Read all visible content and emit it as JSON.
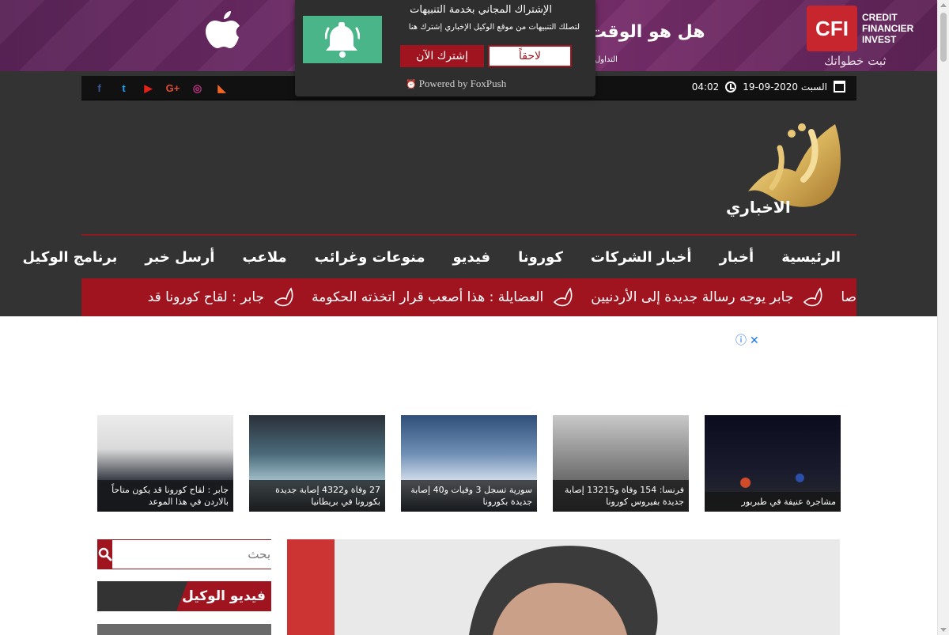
{
  "ad": {
    "headline": "هل هو الوقت",
    "subline": "التداول",
    "cfi_badge": "CFI",
    "cfi_lines": [
      "CREDIT",
      "FINANCIER",
      "INVEST"
    ],
    "cfi_tagline": "ثبت خطواتك"
  },
  "push": {
    "title": "الإشتراك المجاني بخدمة التنبيهات",
    "description": "لتصلك التنبيهات من موقع الوكيل الإخباري إشترك هنا",
    "later_label": "لاحقاً",
    "subscribe_label": "إشترك الآن",
    "powered_by": "Powered by FoxPush"
  },
  "topbar": {
    "date": "السبت 2020-09-19",
    "time": "04:02",
    "social": [
      {
        "name": "facebook-icon",
        "glyph": "f",
        "color": "#3b5998"
      },
      {
        "name": "twitter-icon",
        "glyph": "t",
        "color": "#1da1f2"
      },
      {
        "name": "youtube-icon",
        "glyph": "▶",
        "color": "#e62117"
      },
      {
        "name": "google-plus-icon",
        "glyph": "G+",
        "color": "#dd4b39"
      },
      {
        "name": "instagram-icon",
        "glyph": "◎",
        "color": "#c13584"
      },
      {
        "name": "rss-icon",
        "glyph": "◣",
        "color": "#f26522"
      }
    ]
  },
  "logo": {
    "main": "الوكيل",
    "sub": "الاخباري"
  },
  "nav": {
    "items": [
      "الرئيسية",
      "أخبار",
      "أخبار الشركات",
      "كورونا",
      "فيديو",
      "منوعات وغرائب",
      "ملاعب",
      "أرسل خبر",
      "برنامج الوكيل"
    ]
  },
  "ticker": {
    "items": [
      "صا",
      "جابر يوجه رسالة جديدة إلى الأردنيين",
      "العضايلة : هذا أصعب قرار اتخذته الحكومة",
      "جابر : لقاح كورونا قد"
    ]
  },
  "adchoices": {
    "info": "ⓘ",
    "close": "✕"
  },
  "thumbs": [
    {
      "caption": "مشاجرة عنيفة في طبربور"
    },
    {
      "caption": "فرنسا: 154 وفاة و13215 إصابة جديدة بفيروس كورونا"
    },
    {
      "caption": "سورية تسجل 3 وفيات و40 إصابة جديدة بكورونا"
    },
    {
      "caption": "27 وفاة و4322 إصابة جديدة بكورونا في بريطانيا"
    },
    {
      "caption": "جابر : لقاح كورونا قد يكون متاحاً بالاردن في هذا الموعد"
    }
  ],
  "search": {
    "placeholder": "بحث"
  },
  "video_section": {
    "title": "فيديو الوكيل"
  },
  "colors": {
    "brand_red": "#a0141f",
    "dark": "#333333",
    "push_green": "#4ab589"
  }
}
